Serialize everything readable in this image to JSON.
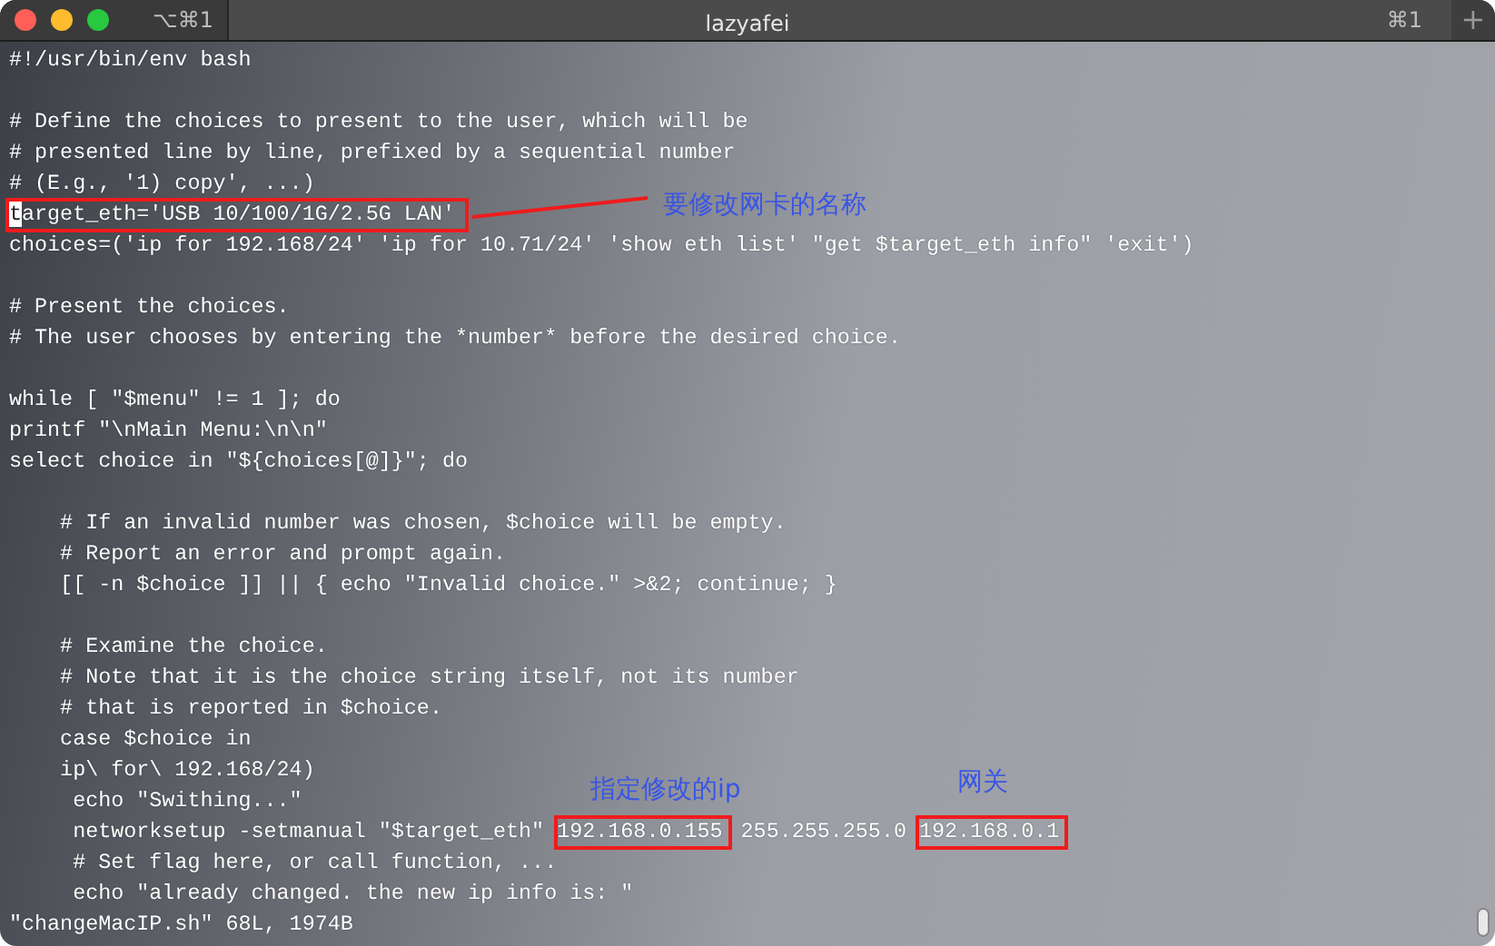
{
  "window": {
    "tab_shortcut": "⌥⌘1",
    "title": "lazyafei",
    "window_shortcut": "⌘1",
    "new_tab": "+"
  },
  "lines": [
    {
      "kind": "code",
      "boxed": false,
      "segments": [
        {
          "kind": "plain",
          "text": "#!/usr/bin/env bash"
        }
      ]
    },
    {
      "kind": "blank"
    },
    {
      "kind": "code",
      "boxed": false,
      "segments": [
        {
          "kind": "plain",
          "text": "# Define the choices to present to the user, which will be"
        }
      ]
    },
    {
      "kind": "code",
      "boxed": false,
      "segments": [
        {
          "kind": "plain",
          "text": "# presented line by line, prefixed by a sequential number"
        }
      ]
    },
    {
      "kind": "code",
      "boxed": false,
      "segments": [
        {
          "kind": "plain",
          "text": "# (E.g., '1) copy', ...)"
        }
      ]
    },
    {
      "kind": "code",
      "boxed": true,
      "segments": [
        {
          "kind": "cursor",
          "text": "t"
        },
        {
          "kind": "plain",
          "text": "arget_eth='USB 10/100/1G/2.5G LAN'"
        }
      ]
    },
    {
      "kind": "code",
      "boxed": false,
      "segments": [
        {
          "kind": "plain",
          "text": "choices=('ip for 192.168/24' 'ip for 10.71/24' 'show eth list' \"get $target_eth info\" 'exit')"
        }
      ]
    },
    {
      "kind": "blank"
    },
    {
      "kind": "code",
      "boxed": false,
      "segments": [
        {
          "kind": "plain",
          "text": "# Present the choices."
        }
      ]
    },
    {
      "kind": "code",
      "boxed": false,
      "segments": [
        {
          "kind": "plain",
          "text": "# The user chooses by entering the *number* before the desired choice."
        }
      ]
    },
    {
      "kind": "blank"
    },
    {
      "kind": "code",
      "boxed": false,
      "segments": [
        {
          "kind": "plain",
          "text": "while [ \"$menu\" != 1 ]; do"
        }
      ]
    },
    {
      "kind": "code",
      "boxed": false,
      "segments": [
        {
          "kind": "plain",
          "text": "printf \"\\nMain Menu:\\n\\n\""
        }
      ]
    },
    {
      "kind": "code",
      "boxed": false,
      "segments": [
        {
          "kind": "plain",
          "text": "select choice in \"${choices[@]}\"; do"
        }
      ]
    },
    {
      "kind": "blank"
    },
    {
      "kind": "code",
      "boxed": false,
      "segments": [
        {
          "kind": "plain",
          "text": "    # If an invalid number was chosen, $choice will be empty."
        }
      ]
    },
    {
      "kind": "code",
      "boxed": false,
      "segments": [
        {
          "kind": "plain",
          "text": "    # Report an error and prompt again."
        }
      ]
    },
    {
      "kind": "code",
      "boxed": false,
      "segments": [
        {
          "kind": "plain",
          "text": "    [[ -n $choice ]] || { echo \"Invalid choice.\" >&2; continue; }"
        }
      ]
    },
    {
      "kind": "blank"
    },
    {
      "kind": "code",
      "boxed": false,
      "segments": [
        {
          "kind": "plain",
          "text": "    # Examine the choice."
        }
      ]
    },
    {
      "kind": "code",
      "boxed": false,
      "segments": [
        {
          "kind": "plain",
          "text": "    # Note that it is the choice string itself, not its number"
        }
      ]
    },
    {
      "kind": "code",
      "boxed": false,
      "segments": [
        {
          "kind": "plain",
          "text": "    # that is reported in $choice."
        }
      ]
    },
    {
      "kind": "code",
      "boxed": false,
      "segments": [
        {
          "kind": "plain",
          "text": "    case $choice in"
        }
      ]
    },
    {
      "kind": "code",
      "boxed": false,
      "segments": [
        {
          "kind": "plain",
          "text": "    ip\\ for\\ 192.168/24)"
        }
      ]
    },
    {
      "kind": "code",
      "boxed": false,
      "segments": [
        {
          "kind": "plain",
          "text": "     echo \"Swithing...\""
        }
      ]
    },
    {
      "kind": "code",
      "boxed": false,
      "segments": [
        {
          "kind": "plain",
          "text": "     networksetup -setmanual \"$target_eth\" "
        },
        {
          "kind": "boxed",
          "text": "192.168.0.155"
        },
        {
          "kind": "plain",
          "text": " 255.255.255.0 "
        },
        {
          "kind": "boxed",
          "text": "192.168.0.1"
        }
      ]
    },
    {
      "kind": "code",
      "boxed": false,
      "segments": [
        {
          "kind": "plain",
          "text": "     # Set flag here, or call function, ..."
        }
      ]
    },
    {
      "kind": "code",
      "boxed": false,
      "segments": [
        {
          "kind": "plain",
          "text": "     echo \"already changed. the new ip info is: \""
        }
      ]
    }
  ],
  "status_line": "\"changeMacIP.sh\" 68L, 1974B",
  "annotations": [
    {
      "text": "要修改网卡的名称"
    },
    {
      "text": "指定修改的ip"
    },
    {
      "text": "网关"
    }
  ]
}
